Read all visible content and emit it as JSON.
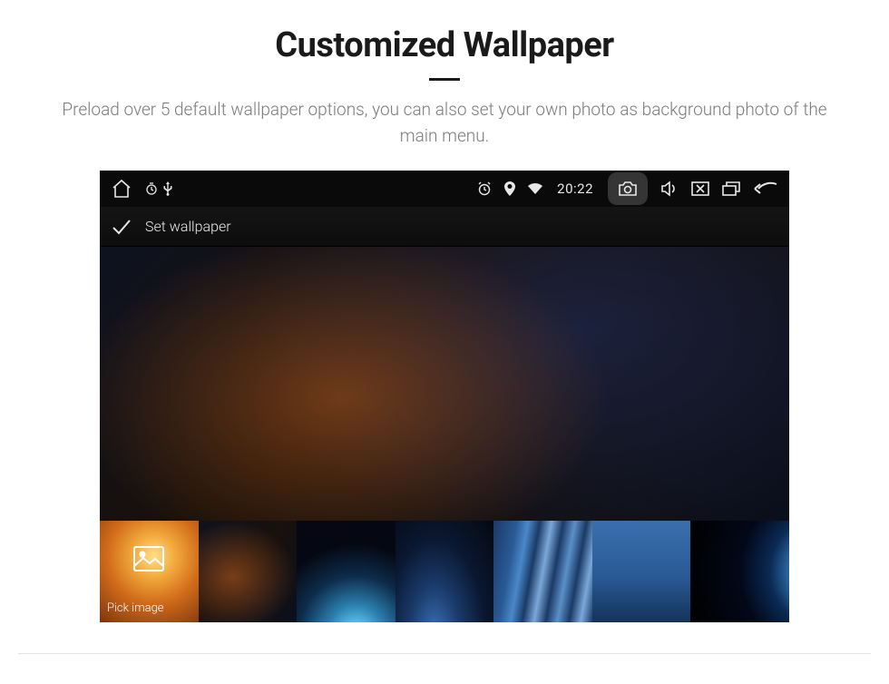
{
  "header": {
    "title": "Customized Wallpaper",
    "subtitle": "Preload over 5 default wallpaper options, you can also set your own photo as background photo of the main menu."
  },
  "status_bar": {
    "time": "20:22"
  },
  "action_bar": {
    "label": "Set wallpaper"
  },
  "thumbnails": {
    "pick_label": "Pick image"
  }
}
